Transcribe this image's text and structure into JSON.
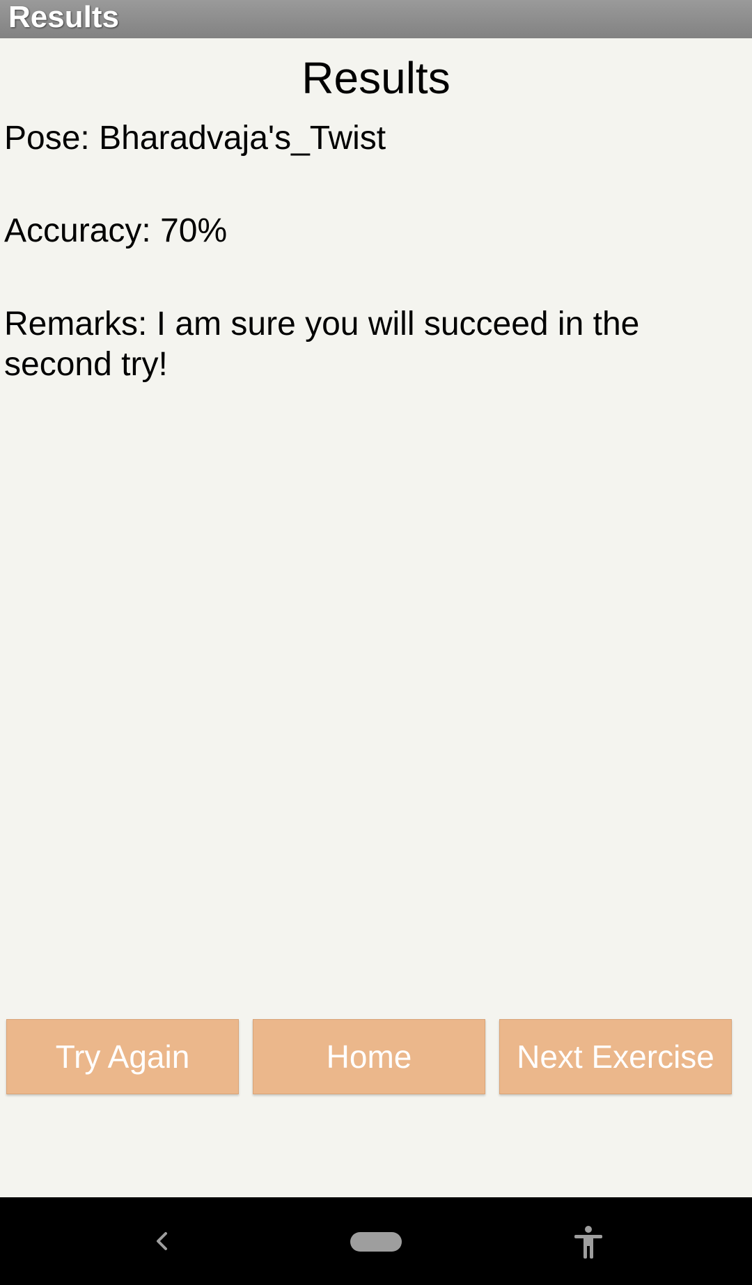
{
  "titlebar": {
    "title": "Results"
  },
  "main": {
    "heading": "Results",
    "pose": "Pose: Bharadvaja's_Twist",
    "accuracy": "Accuracy: 70%",
    "remarks": "Remarks: I am sure you will succeed in the second try!"
  },
  "buttons": {
    "try_again": "Try Again",
    "home": "Home",
    "next_exercise": "Next Exercise"
  },
  "navbar": {
    "back_icon": "chevron-left-icon",
    "home_icon": "home-pill-icon",
    "accessibility_icon": "accessibility-icon"
  },
  "colors": {
    "background": "#f4f4ef",
    "button": "#ebb78b",
    "titlebar": "#8c8c8c",
    "navbar": "#000000"
  }
}
